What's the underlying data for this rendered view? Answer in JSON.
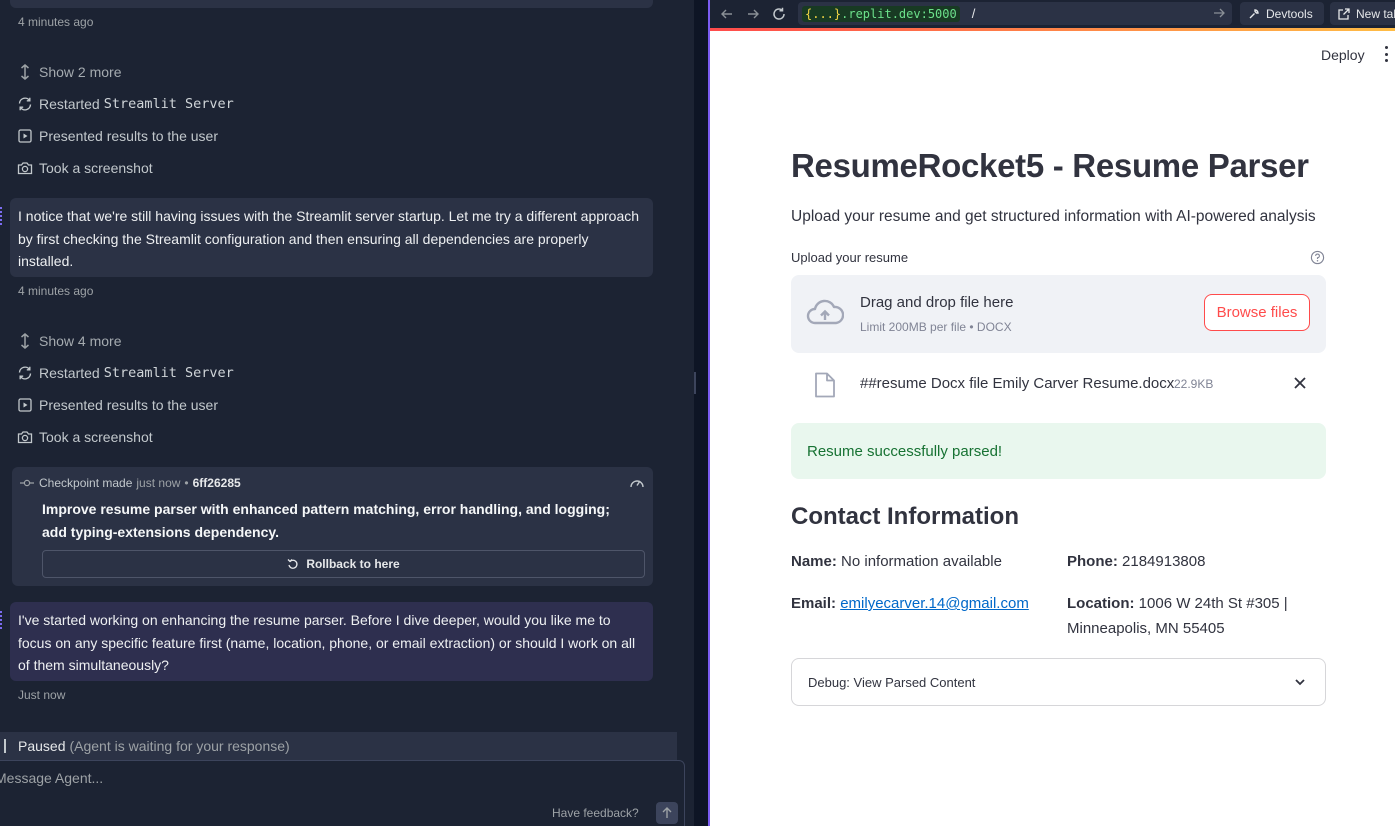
{
  "agent": {
    "timestamps": [
      "4 minutes ago",
      "4 minutes ago",
      "Just now"
    ],
    "group1": {
      "show_more": "Show 2 more",
      "restarted_prefix": "Restarted",
      "restarted_code": "Streamlit Server",
      "presented": "Presented results to the user",
      "screenshot": "Took a screenshot"
    },
    "message1": "I notice that we're still having issues with the Streamlit server startup. Let me try a different approach by first checking the Streamlit configuration and then ensuring all dependencies are properly installed.",
    "group2": {
      "show_more": "Show 4 more",
      "restarted_prefix": "Restarted",
      "restarted_code": "Streamlit Server",
      "presented": "Presented results to the user",
      "screenshot": "Took a screenshot"
    },
    "checkpoint": {
      "label": "Checkpoint made",
      "when": "just now",
      "hash": "6ff26285",
      "description": "Improve resume parser with enhanced pattern matching, error handling, and logging; add typing-extensions dependency.",
      "rollback_label": "Rollback to here"
    },
    "message2": "I've started working on enhancing the resume parser. Before I dive deeper, would you like me to focus on any specific feature first (name, location, phone, or email extraction) or should I work on all of them simultaneously?",
    "status": {
      "label": "Paused",
      "detail": "(Agent is waiting for your response)"
    },
    "input": {
      "placeholder": "Message Agent...",
      "feedback": "Have feedback?"
    }
  },
  "browser": {
    "url_host_brace": "{...}",
    "url_host": ".replit.dev:5000",
    "url_path": "/",
    "devtools": "Devtools",
    "new_tab": "New tab"
  },
  "app": {
    "deploy": "Deploy",
    "title": "ResumeRocket5 - Resume Parser",
    "subtitle": "Upload your resume and get structured information with AI-powered analysis",
    "upload_label": "Upload your resume",
    "dropzone": {
      "title": "Drag and drop file here",
      "limit": "Limit 200MB per file • DOCX",
      "browse": "Browse files"
    },
    "file": {
      "name": "##resume Docx file Emily Carver Resume.docx",
      "size": "22.9KB"
    },
    "success": "Resume successfully parsed!",
    "contact": {
      "heading": "Contact Information",
      "name_label": "Name:",
      "name_value": "No information available",
      "phone_label": "Phone:",
      "phone_value": "2184913808",
      "email_label": "Email:",
      "email_value": "emilyecarver.14@gmail.com",
      "location_label": "Location:",
      "location_line1": "1006 W 24th St #305 |",
      "location_line2": "Minneapolis, MN 55405"
    },
    "debug": "Debug: View Parsed Content"
  },
  "colors": {
    "accent": "#ff4b4b",
    "success_bg": "#e9f7ee",
    "success_text": "#177233",
    "link": "#0068c9",
    "panel_bg": "#1c2333",
    "card_bg": "#2b3245"
  }
}
